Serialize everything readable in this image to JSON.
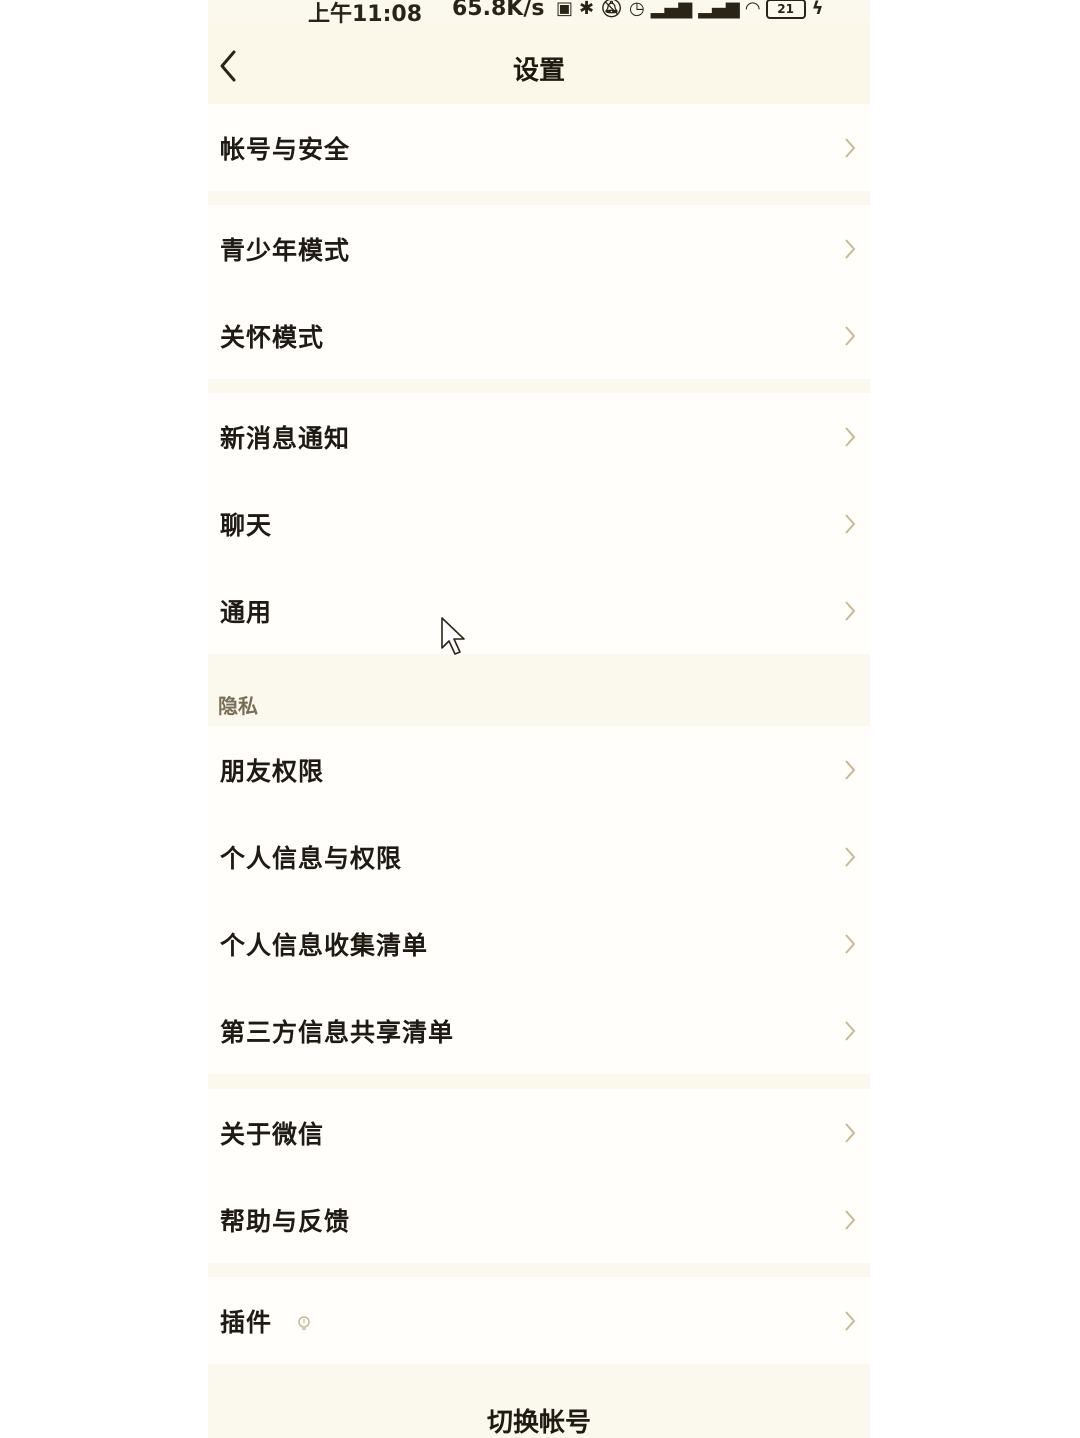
{
  "status_bar": {
    "time": "上午11:08",
    "speed": "65.8K/s",
    "battery": "21"
  },
  "nav": {
    "title": "设置"
  },
  "groups": [
    {
      "items": [
        {
          "label": "帐号与安全"
        }
      ]
    },
    {
      "items": [
        {
          "label": "青少年模式"
        },
        {
          "label": "关怀模式"
        }
      ]
    },
    {
      "items": [
        {
          "label": "新消息通知"
        },
        {
          "label": "聊天"
        },
        {
          "label": "通用"
        }
      ]
    },
    {
      "section": "隐私",
      "items": [
        {
          "label": "朋友权限"
        },
        {
          "label": "个人信息与权限"
        },
        {
          "label": "个人信息收集清单"
        },
        {
          "label": "第三方信息共享清单"
        }
      ]
    },
    {
      "items": [
        {
          "label": "关于微信"
        },
        {
          "label": "帮助与反馈"
        }
      ]
    },
    {
      "items": [
        {
          "label": "插件"
        }
      ]
    }
  ],
  "footer": {
    "switch_account": "切换帐号"
  },
  "colors": {
    "background": "#fbf8ee",
    "card": "#fffefb",
    "text": "#1f1a12",
    "chevron": "#c9b98c"
  }
}
